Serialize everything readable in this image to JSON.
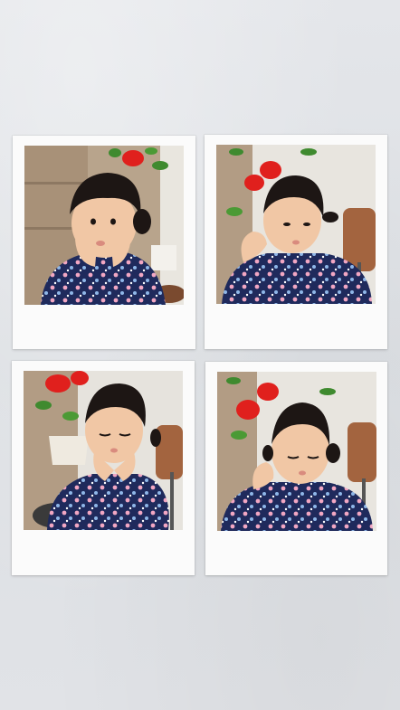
{
  "collage": {
    "frame_color": "#fbfbfb",
    "background_color": "#dfe1e5",
    "photos": [
      {
        "subject": "child-hands-on-cheeks",
        "pose": "looking-left-hands-cupping-face"
      },
      {
        "subject": "child-leaning-on-hand",
        "pose": "looking-down-right-head-on-hand"
      },
      {
        "subject": "child-hands-on-chin",
        "pose": "eyes-closed-hands-under-chin"
      },
      {
        "subject": "child-hand-by-ear",
        "pose": "looking-down-left-hand-on-cheek"
      }
    ],
    "colors": {
      "kimono": "#1f2a5c",
      "flower_pink": "#f2a7c3",
      "flower_blue": "#8fb7e8",
      "rose_red": "#e0201d",
      "leaf_green": "#3f8a2f",
      "skin": "#f1c7a5",
      "hair": "#1d1614",
      "chair": "#a3643f",
      "stone_wall": "#b29c84"
    }
  }
}
